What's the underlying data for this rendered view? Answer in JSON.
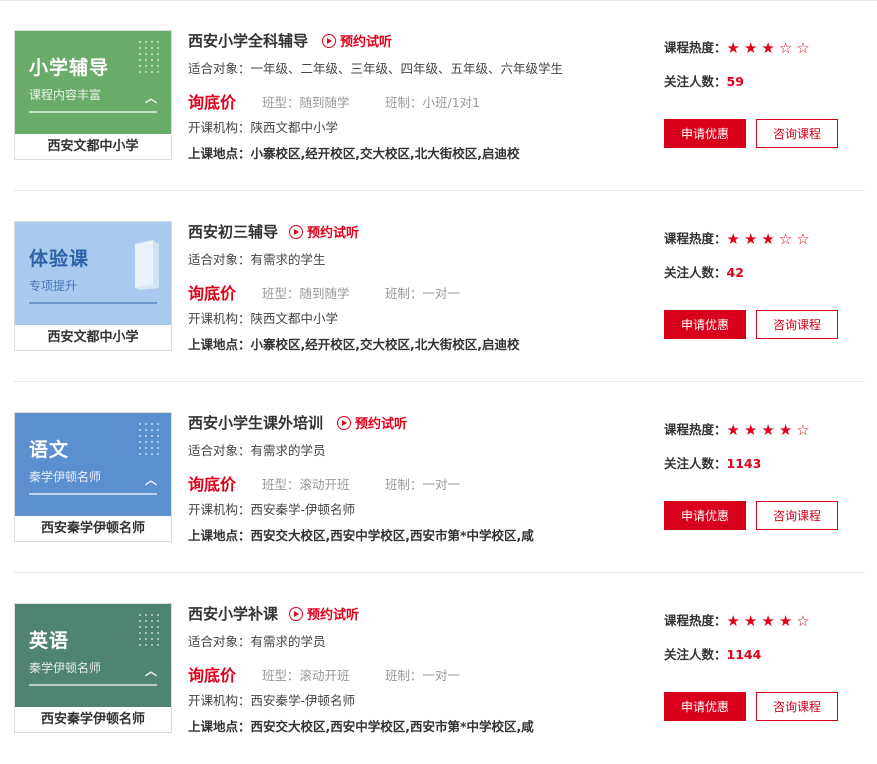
{
  "labels": {
    "trial": "预约试听",
    "target_prefix": "适合对象：",
    "price": "询底价",
    "class_type_prefix": "班型：",
    "class_size_prefix": "班制：",
    "org_prefix": "开课机构：",
    "location_prefix": "上课地点：",
    "heat_label": "课程热度：",
    "follow_label": "关注人数：",
    "apply_button": "申请优惠",
    "consult_button": "咨询课程"
  },
  "colors": {
    "accent": "#d9001b"
  },
  "courses": [
    {
      "thumb": {
        "title": "小学辅导",
        "subtitle": "课程内容丰富",
        "caption": "西安文都中小学",
        "bg": "#6aab6a",
        "icon": "dots-pattern"
      },
      "title": "西安小学全科辅导",
      "target": "一年级、二年级、三年级、四年级、五年级、六年级学生",
      "class_type": "随到随学",
      "class_size": "小班/1对1",
      "org": "陕西文都中小学",
      "location": "小寨校区,经开校区,交大校区,北大街校区,启迪校",
      "stars": "★★★☆☆",
      "rating": 3,
      "followers": "59"
    },
    {
      "thumb": {
        "title": "体验课",
        "subtitle": "专项提升",
        "caption": "西安文都中小学",
        "bg": "#a9c9ee",
        "icon": "book-icon"
      },
      "title": "西安初三辅导",
      "target": "有需求的学生",
      "class_type": "随到随学",
      "class_size": "一对一",
      "org": "陕西文都中小学",
      "location": "小寨校区,经开校区,交大校区,北大街校区,启迪校",
      "stars": "★★★☆☆",
      "rating": 3,
      "followers": "42"
    },
    {
      "thumb": {
        "title": "语文",
        "subtitle": "秦学伊顿名师",
        "caption": "西安秦学伊顿名师",
        "bg": "#5b8fd0",
        "icon": "dots-pattern"
      },
      "title": "西安小学生课外培训",
      "target": "有需求的学员",
      "class_type": "滚动开班",
      "class_size": "一对一",
      "org": "西安秦学-伊顿名师",
      "location": "西安交大校区,西安中学校区,西安市第*中学校区,咸",
      "stars": "★★★★☆",
      "rating": 4,
      "followers": "1143"
    },
    {
      "thumb": {
        "title": "英语",
        "subtitle": "秦学伊顿名师",
        "caption": "西安秦学伊顿名师",
        "bg": "#4f8374",
        "icon": "dots-pattern"
      },
      "title": "西安小学补课",
      "target": "有需求的学员",
      "class_type": "滚动开班",
      "class_size": "一对一",
      "org": "西安秦学-伊顿名师",
      "location": "西安交大校区,西安中学校区,西安市第*中学校区,咸",
      "stars": "★★★★☆",
      "rating": 4,
      "followers": "1144"
    }
  ]
}
